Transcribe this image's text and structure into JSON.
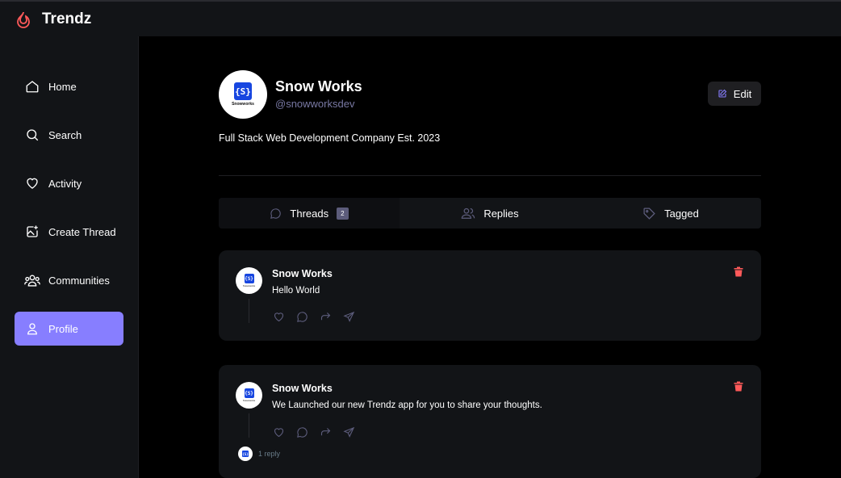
{
  "app": {
    "brand": "Trendz",
    "accent": "#877eff",
    "logo_color": "#ff5a5a"
  },
  "sidebar": {
    "items": [
      {
        "label": "Home",
        "icon": "home-icon",
        "active": false
      },
      {
        "label": "Search",
        "icon": "search-icon",
        "active": false
      },
      {
        "label": "Activity",
        "icon": "heart-icon",
        "active": false
      },
      {
        "label": "Create Thread",
        "icon": "image-plus-icon",
        "active": false
      },
      {
        "label": "Communities",
        "icon": "users-icon",
        "active": false
      },
      {
        "label": "Profile",
        "icon": "user-icon",
        "active": true
      }
    ]
  },
  "profile": {
    "name": "Snow Works",
    "handle": "@snowworksdev",
    "bio": "Full Stack Web Development Company Est. 2023",
    "avatar_text": "{S}",
    "avatar_caption": "Snowworks",
    "edit_label": "Edit"
  },
  "tabs": [
    {
      "label": "Threads",
      "icon": "message-circle-icon",
      "count": "2",
      "active": true
    },
    {
      "label": "Replies",
      "icon": "users-icon",
      "active": false
    },
    {
      "label": "Tagged",
      "icon": "tag-icon",
      "active": false
    }
  ],
  "threads": [
    {
      "author": "Snow Works",
      "content": "Hello World",
      "replies": ""
    },
    {
      "author": "Snow Works",
      "content": "We Launched our new Trendz app for you to share your thoughts.",
      "replies": "1 reply"
    }
  ],
  "colors": {
    "delete": "#ff5a5a",
    "muted": "#7878a3"
  }
}
